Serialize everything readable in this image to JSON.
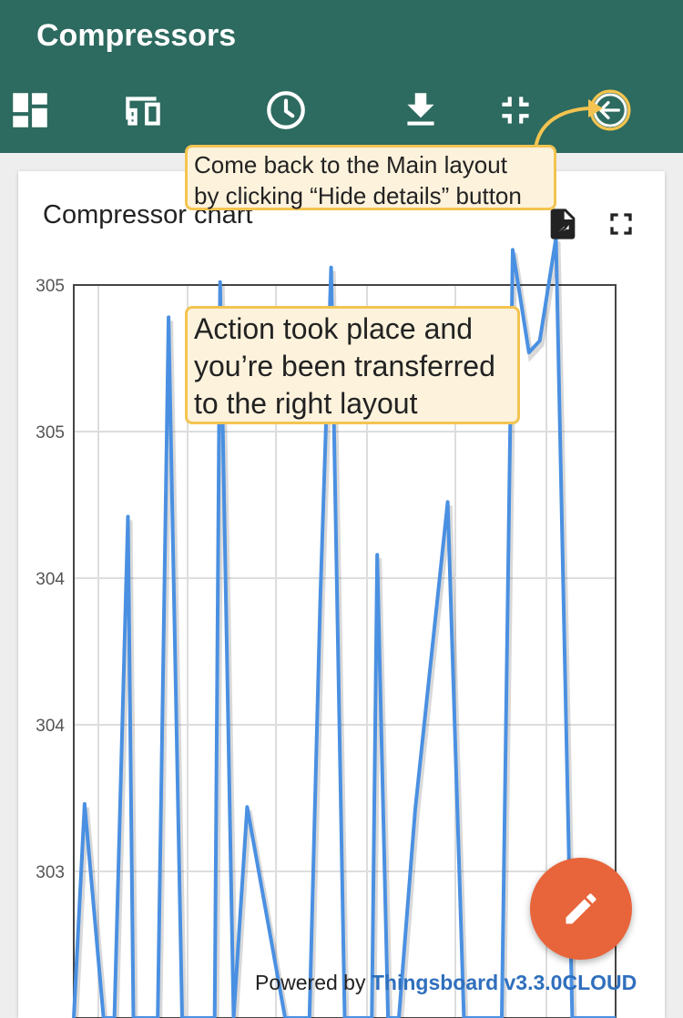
{
  "header": {
    "title": "Compressors"
  },
  "toolbar": {
    "icons": [
      "dashboard-icon",
      "devices-icon",
      "clock-icon",
      "download-icon",
      "fullscreen-exit-icon",
      "back-arrow-icon"
    ]
  },
  "card": {
    "title": "Compressor chart",
    "icons": [
      "export-file-icon",
      "fullscreen-icon"
    ]
  },
  "callouts": {
    "back_hint_lines": [
      "Come back to the Main layout",
      "by clicking “Hide details” button"
    ],
    "transfer_hint_lines": [
      "Action took place and",
      "you’re been transferred",
      "to the right layout"
    ]
  },
  "footer": {
    "powered_prefix": "Powered by ",
    "powered_brand": "Thingsboard v3.3.0CLOUD"
  },
  "colors": {
    "appbar": "#2d6a5f",
    "series_line": "#4a90e2",
    "callout_border": "#f3c451",
    "callout_fill": "#fdf2dc",
    "fab": "#e8643a",
    "brand_link": "#2f6fbd"
  },
  "chart_data": {
    "type": "line",
    "title": "Compressor chart",
    "xlabel": "",
    "ylabel": "",
    "y_tick_labels": [
      "305",
      "305",
      "304",
      "304",
      "303"
    ],
    "y_ticks": [
      305.5,
      305.0,
      304.5,
      304.0,
      303.5
    ],
    "ylim": [
      303.5,
      305.5
    ],
    "grid": true,
    "series": [
      {
        "x": [
          0.0,
          0.2,
          0.55,
          0.75,
          1.0,
          1.1,
          1.55,
          1.75,
          2.0,
          2.3,
          2.6,
          2.7,
          2.95,
          3.2,
          3.9,
          4.0,
          4.35,
          4.55,
          4.75,
          5.0,
          5.4,
          5.5,
          5.6,
          5.8,
          6.0,
          6.3,
          6.9,
          7.2,
          7.5,
          7.9,
          8.1,
          8.4,
          8.6,
          8.9,
          9.2,
          9.4,
          9.65,
          9.95,
          10.0
        ],
        "y": [
          303.0,
          303.73,
          303.0,
          303.0,
          304.71,
          303.0,
          303.0,
          305.39,
          303.0,
          303.0,
          303.0,
          305.51,
          303.0,
          303.72,
          303.0,
          303.0,
          303.0,
          304.43,
          305.56,
          303.0,
          303.0,
          303.0,
          304.58,
          303.0,
          303.0,
          303.71,
          304.76,
          303.0,
          303.0,
          303.0,
          305.62,
          305.27,
          305.31,
          305.66,
          303.0,
          303.0,
          303.0,
          303.0,
          303.0
        ]
      }
    ]
  }
}
